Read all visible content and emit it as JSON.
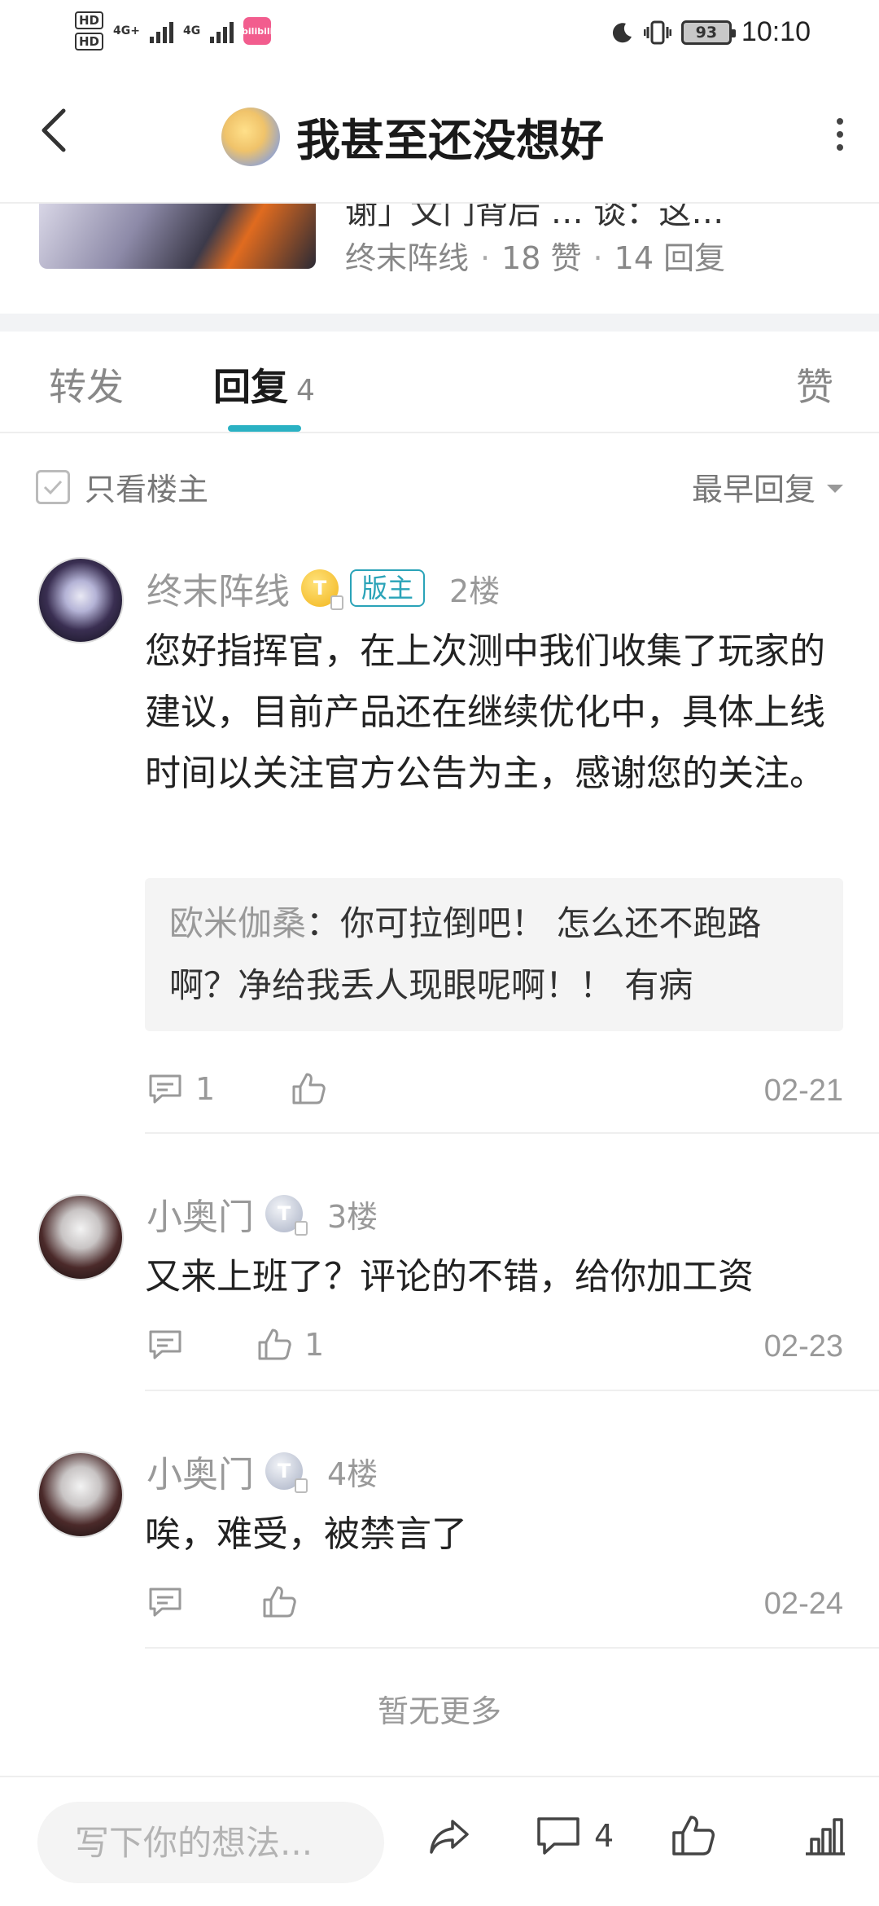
{
  "status_bar": {
    "hd1": "HD",
    "hd2": "HD",
    "net1": "4G+",
    "net2": "4G",
    "app_badge": "bilibili",
    "battery": "93",
    "time": "10:10"
  },
  "header": {
    "title": "我甚至还没想好"
  },
  "origin_post": {
    "title_cut": "谢」文门背后 … 谈：这…",
    "author": "终末阵线",
    "likes": "18 赞",
    "replies": "14 回复"
  },
  "tabs": {
    "forward": "转发",
    "reply": "回复",
    "reply_count": "4",
    "like": "赞"
  },
  "filter": {
    "only_owner": "只看楼主",
    "sort": "最早回复"
  },
  "comments": [
    {
      "name": "终末阵线",
      "badge": "T",
      "tag": "版主",
      "floor": "2楼",
      "text": "您好指挥官，在上次测中我们收集了玩家的建议，目前产品还在继续优化中，具体上线时间以关注官方公告为主，感谢您的关注。",
      "quote_name": "欧米伽桑",
      "quote_text": "：你可拉倒吧！ 怎么还不跑路啊？净给我丢人现眼呢啊！！ 有病",
      "reply_count": "1",
      "like_count": "",
      "date": "02-21"
    },
    {
      "name": "小奥门",
      "badge": "T",
      "floor": "3楼",
      "text": "又来上班了？评论的不错，给你加工资",
      "reply_count": "",
      "like_count": "1",
      "date": "02-23"
    },
    {
      "name": "小奥门",
      "badge": "T",
      "floor": "4楼",
      "text": "唉，难受，被禁言了",
      "reply_count": "",
      "like_count": "",
      "date": "02-24"
    }
  ],
  "no_more": "暂无更多",
  "bottom_bar": {
    "input_placeholder": "写下你的想法...",
    "comment_count": "4"
  },
  "colors": {
    "accent": "#2ab1c3",
    "mod_tag": "#2aa3b8",
    "muted_text": "#999999"
  }
}
